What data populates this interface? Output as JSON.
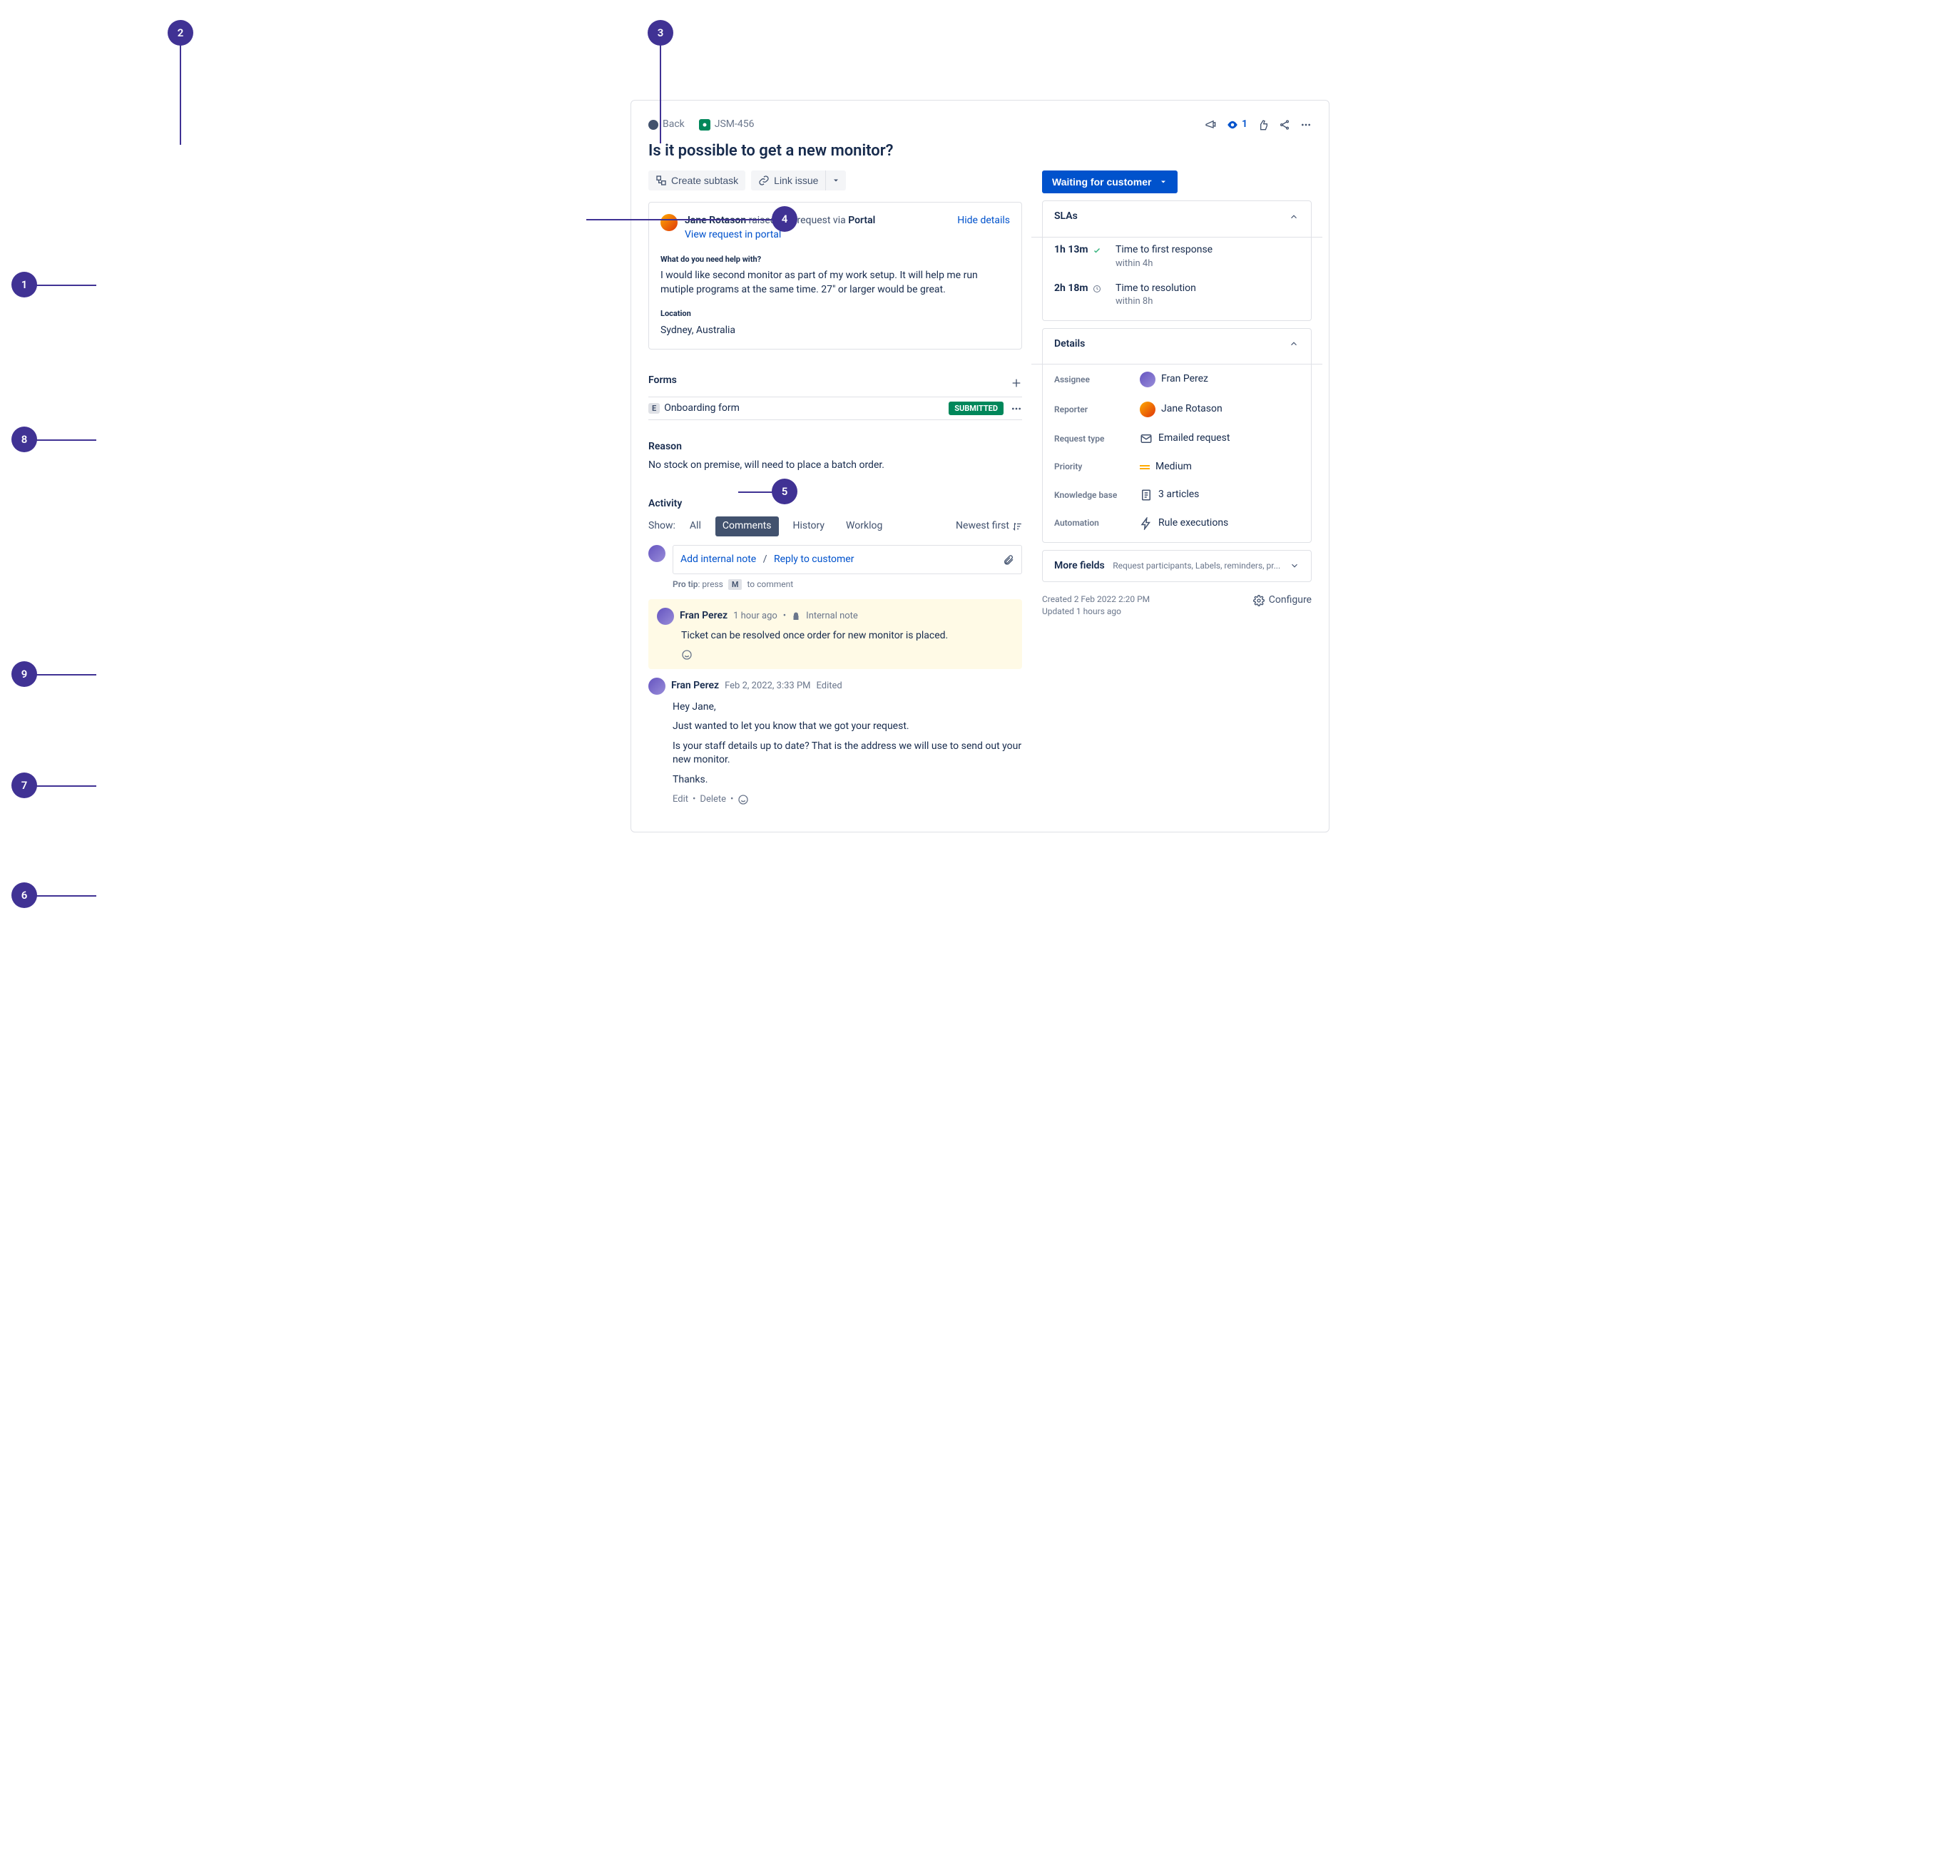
{
  "callouts": {
    "1": "1",
    "2": "2",
    "3": "3",
    "4": "4",
    "5": "5",
    "6": "6",
    "7": "7",
    "8": "8",
    "9": "9"
  },
  "breadcrumb": {
    "back": "Back",
    "issue_key": "JSM-456"
  },
  "top_actions": {
    "watch_count": "1"
  },
  "title": "Is it possible to get a new monitor?",
  "buttons": {
    "create_subtask": "Create subtask",
    "link_issue": "Link issue"
  },
  "request": {
    "reporter": "Jane Rotason",
    "raised": " raised this request via ",
    "channel": "Portal",
    "hide": "Hide details",
    "portal_link": "View request in portal",
    "q_label": "What do you need help with?",
    "q_body": "I would like second monitor as part of my work setup. It will help me run mutiple programs at the same time. 27\" or larger would be great.",
    "loc_label": "Location",
    "loc_body": "Sydney, Australia"
  },
  "forms": {
    "title": "Forms",
    "item_name": "Onboarding form",
    "badge_e": "E",
    "status": "SUBMITTED"
  },
  "reason": {
    "title": "Reason",
    "body": "No stock on premise, will need to place a batch order."
  },
  "activity": {
    "title": "Activity",
    "show": "Show:",
    "tabs": {
      "all": "All",
      "comments": "Comments",
      "history": "History",
      "worklog": "Worklog"
    },
    "sort": "Newest first",
    "compose": {
      "internal": "Add internal note",
      "sep": "/",
      "reply": "Reply to customer"
    },
    "protip_pre": "Pro tip",
    "protip_mid": ": press",
    "kbd": "M",
    "protip_post": "to comment",
    "note": {
      "author": "Fran Perez",
      "time": "1 hour ago",
      "dot": "•",
      "label": "Internal note",
      "body": "Ticket can be resolved once order for new monitor is placed."
    },
    "comment": {
      "author": "Fran Perez",
      "time": "Feb 2, 2022, 3:33 PM",
      "edited": "Edited",
      "p1": "Hey Jane,",
      "p2": "Just wanted to let you know that we got your request.",
      "p3": "Is your staff details up to date? That is the address we will use to send out your new monitor.",
      "p4": "Thanks.",
      "edit": "Edit",
      "delete": "Delete",
      "dot": "•"
    }
  },
  "status": "Waiting for customer",
  "slas": {
    "title": "SLAs",
    "rows": [
      {
        "time": "1h 13m",
        "name": "Time to first response",
        "within": "within 4h",
        "ok": true
      },
      {
        "time": "2h 18m",
        "name": "Time to resolution",
        "within": "within 8h",
        "ok": false
      }
    ]
  },
  "details": {
    "title": "Details",
    "assignee_label": "Assignee",
    "assignee": "Fran Perez",
    "reporter_label": "Reporter",
    "reporter": "Jane Rotason",
    "reqtype_label": "Request type",
    "reqtype": "Emailed request",
    "priority_label": "Priority",
    "priority": "Medium",
    "kb_label": "Knowledge base",
    "kb": "3 articles",
    "auto_label": "Automation",
    "auto": "Rule executions"
  },
  "more_fields": {
    "title": "More fields",
    "sub": "Request participants, Labels, reminders, pr..."
  },
  "footer": {
    "created": "Created 2 Feb 2022 2:20 PM",
    "updated": "Updated 1 hours ago",
    "configure": "Configure"
  }
}
